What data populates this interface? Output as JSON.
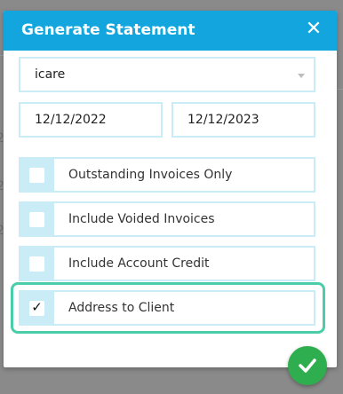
{
  "modal": {
    "title": "Generate Statement",
    "close_label": "✕",
    "client_select": {
      "value": "icare"
    },
    "date_from": "12/12/2022",
    "date_to": "12/12/2023",
    "options": [
      {
        "label": "Outstanding Invoices Only",
        "checked": false
      },
      {
        "label": "Include Voided Invoices",
        "checked": false
      },
      {
        "label": "Include Account Credit",
        "checked": false
      },
      {
        "label": "Address to Client",
        "checked": true
      }
    ],
    "check_mark": "✓"
  },
  "colors": {
    "header": "#13a6de",
    "field_border": "#c9ecf7",
    "highlight": "#4ccdaa",
    "confirm": "#2fae4f"
  },
  "icons": {
    "close": "close-icon",
    "confirm": "checkmark-icon",
    "dropdown": "chevron-down-icon"
  }
}
